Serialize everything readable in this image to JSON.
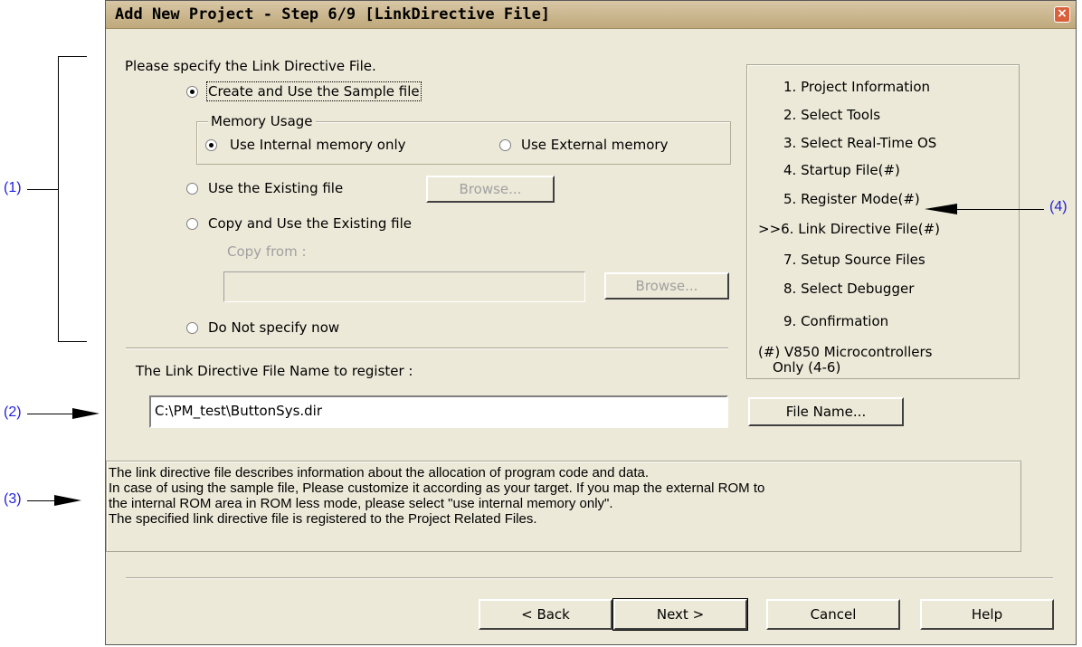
{
  "window": {
    "title": "Add New Project - Step 6/9 [LinkDirective File]",
    "close_glyph": "×"
  },
  "prompt": "Please specify the Link Directive File.",
  "options": {
    "create_sample": {
      "label": "Create and Use the Sample file",
      "selected": true
    },
    "memory_usage": {
      "group_label": "Memory Usage",
      "internal": {
        "label": "Use Internal memory only",
        "selected": true
      },
      "external": {
        "label": "Use External memory",
        "selected": false
      }
    },
    "use_existing": {
      "label": "Use the Existing file",
      "selected": false
    },
    "copy_existing": {
      "label": "Copy and Use the Existing file",
      "selected": false
    },
    "copy_from_label": "Copy from :",
    "copy_from_value": "",
    "do_not_specify": {
      "label": "Do Not specify now",
      "selected": false
    },
    "browse_label": "Browse..."
  },
  "register": {
    "label": "The Link Directive File Name to register :",
    "value": "C:\\PM_test\\ButtonSys.dir",
    "file_name_button": "File Name..."
  },
  "steps": {
    "items": [
      "1. Project Information",
      "2. Select Tools",
      "3. Select Real-Time OS",
      "4. Startup File(#)",
      "5. Register Mode(#)",
      ">>6. Link Directive File(#)",
      "7. Setup Source Files",
      "8. Select Debugger",
      "9. Confirmation"
    ],
    "footnote_line1": "(#) V850 Microcontrollers",
    "footnote_line2": "Only (4-6)",
    "current_step": 6
  },
  "description": {
    "line1": "The link directive file describes information about the allocation of program code and data.",
    "line2": "In case of using the sample file, Please customize it according as your target. If you map the external ROM to",
    "line3": "the internal ROM area in ROM less mode, please select \"use internal memory only\".",
    "line4": "The specified link directive file is registered to the Project Related Files."
  },
  "buttons": {
    "back": "< Back",
    "next": "Next >",
    "cancel": "Cancel",
    "help": "Help"
  },
  "annotations": {
    "a1": "(1)",
    "a2": "(2)",
    "a3": "(3)",
    "a4": "(4)"
  },
  "colors": {
    "dialog_bg": "#ece9d8",
    "annotation": "#2222dd",
    "close_button": "#d9603b"
  }
}
